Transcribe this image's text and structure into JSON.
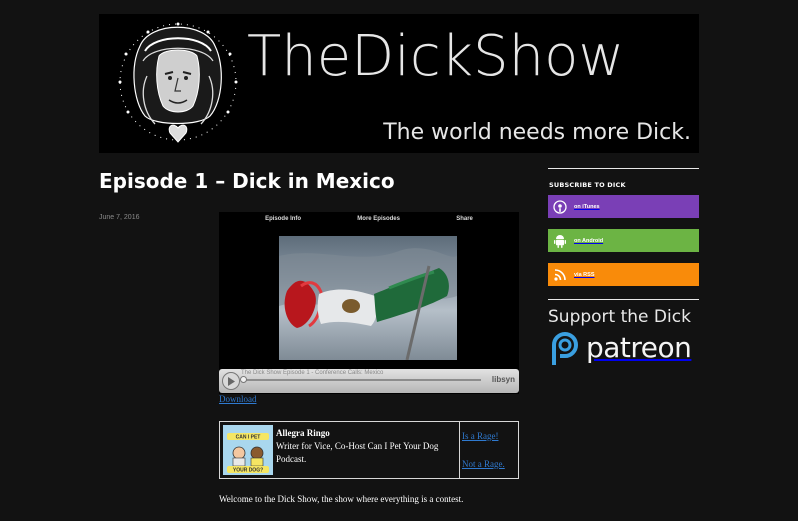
{
  "header": {
    "site_title": "TheDickShow",
    "tagline": "The world needs more Dick."
  },
  "post": {
    "title": "Episode 1 – Dick in Mexico",
    "date": "June 7, 2016",
    "player": {
      "nav": [
        "Episode Info",
        "More Episodes",
        "Share"
      ],
      "caption": "The Dick Show Episode 1 - Conference Calls: Mexico",
      "brand": "libsyn",
      "progress": 0
    },
    "download_label": "Download",
    "guest": {
      "name": "Allegra Ringo",
      "bio": "Writer for Vice, Co-Host Can I Pet Your Dog Podcast.",
      "rage_label": "Is a Rage!",
      "not_rage_label": "Not a Rage."
    },
    "intro": "Welcome to the Dick Show, the show where everything is a contest."
  },
  "sidebar": {
    "subscribe_heading": "SUBSCRIBE TO DICK",
    "buttons": [
      {
        "label": "on iTunes",
        "icon": "podcast-icon",
        "color": "#7a3fb6"
      },
      {
        "label": "on Android",
        "icon": "android-icon",
        "color": "#6cb444"
      },
      {
        "label": "via RSS",
        "icon": "rss-icon",
        "color": "#f98b0a"
      }
    ],
    "support_text": "Support the Dick",
    "patreon_label": "patreon"
  },
  "colors": {
    "background": "#121212",
    "link": "#2f7ad0"
  }
}
